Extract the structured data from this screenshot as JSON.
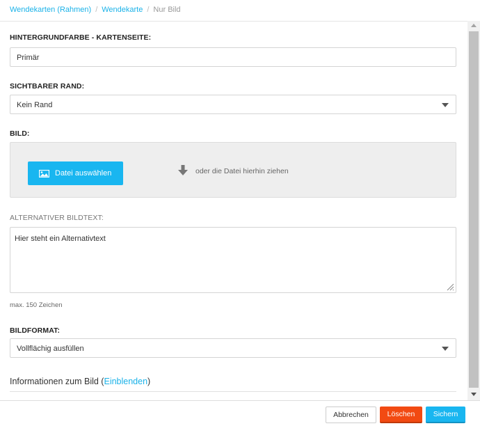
{
  "breadcrumb": {
    "items": [
      "Wendekarten (Rahmen)",
      "Wendekarte"
    ],
    "separator": "/",
    "current": "Nur Bild"
  },
  "background": {
    "label": "HINTERGRUNDFARBE - KARTENSEITE:",
    "value": "Primär"
  },
  "border": {
    "label": "SICHTBARER RAND:",
    "value": "Kein Rand"
  },
  "image": {
    "label": "BILD:",
    "select_button": "Datei auswählen",
    "drop_text": "oder die Datei hierhin ziehen",
    "icons": {
      "button": "image-icon",
      "drop": "arrow-down-icon"
    }
  },
  "alt_text": {
    "label": "ALTERNATIVER BILDTEXT:",
    "value": "Hier steht ein Alternativtext",
    "hint": "max. 150 Zeichen"
  },
  "format": {
    "label": "BILDFORMAT:",
    "value": "Vollflächig ausfüllen"
  },
  "info": {
    "prefix": "Informationen zum Bild (",
    "link": "Einblenden",
    "suffix": ")"
  },
  "footer": {
    "cancel": "Abbrechen",
    "delete": "Löschen",
    "save": "Sichern"
  },
  "colors": {
    "accent": "#19b6f0",
    "danger": "#f24a12",
    "link": "#1ab2e8"
  }
}
